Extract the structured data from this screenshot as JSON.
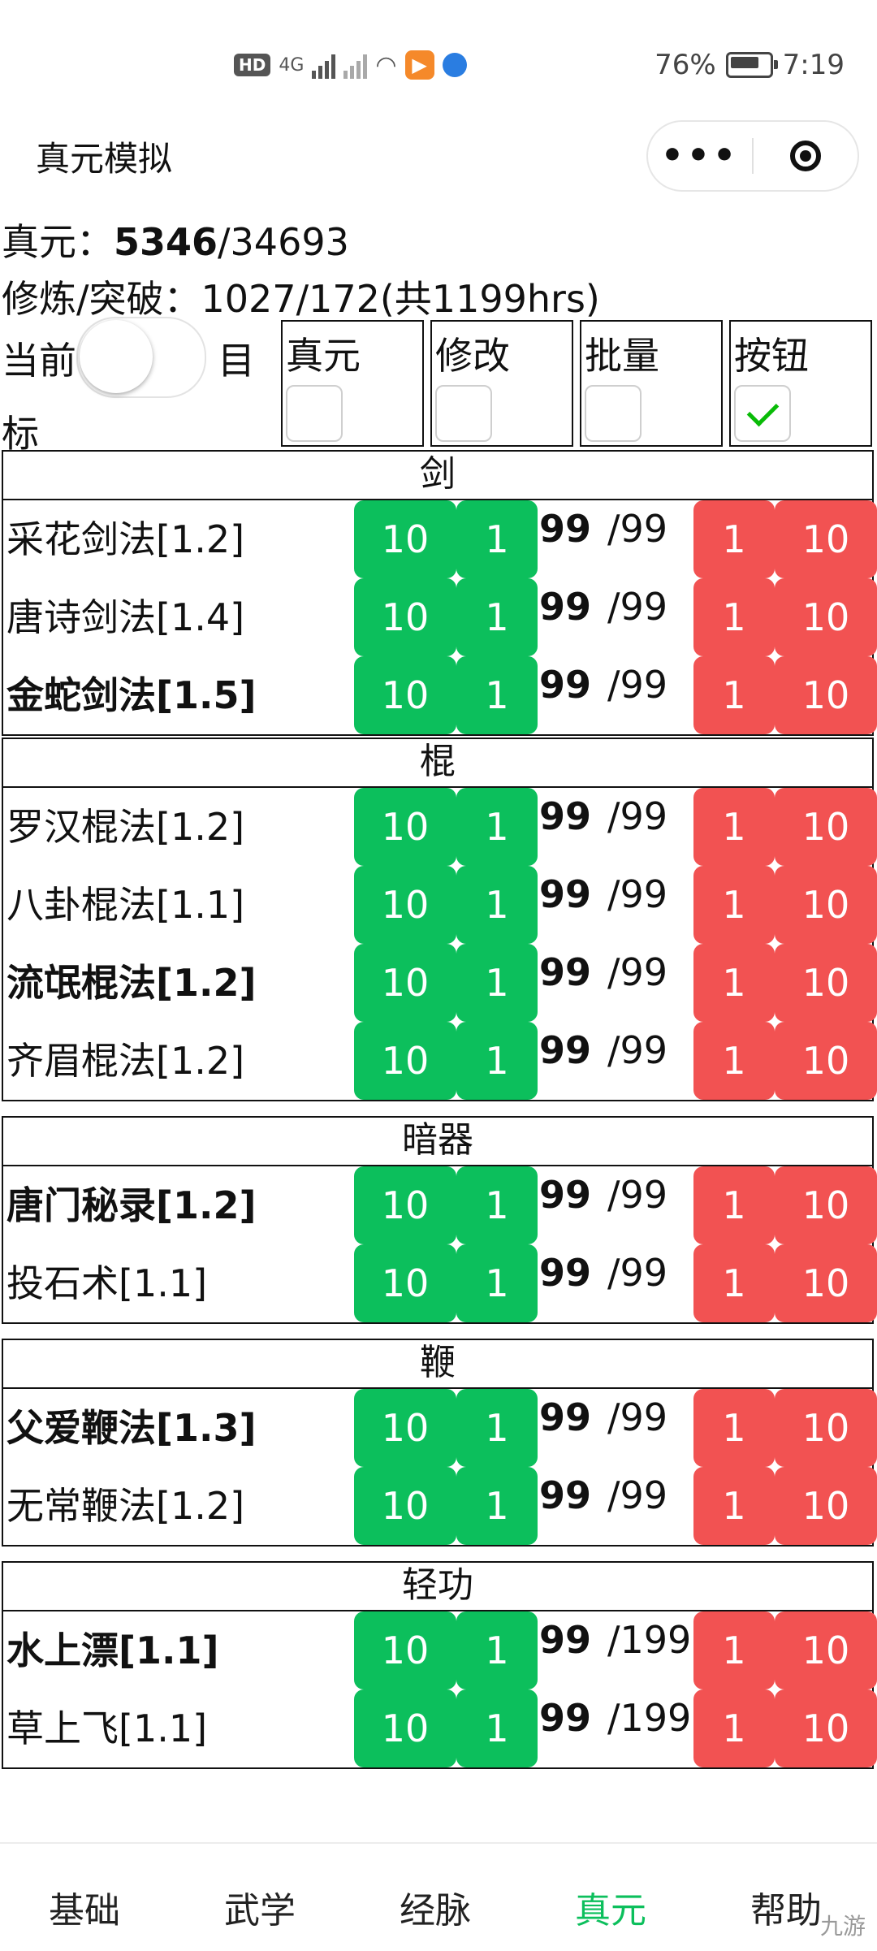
{
  "status_bar": {
    "hd_label": "HD",
    "network_label": "4G",
    "battery": "76%",
    "time": "7:19"
  },
  "nav": {
    "title": "真元模拟"
  },
  "summary": {
    "zhenyuan_label": "真元：",
    "zhenyuan_current": "5346",
    "zhenyuan_total": "/34693",
    "training_label": "修炼/突破：1027/172(共1199hrs)"
  },
  "toggle": {
    "left_label": "当前",
    "right_label_1": "目",
    "right_label_2": "标",
    "is_on": false
  },
  "options": [
    {
      "label": "真元",
      "checked": false
    },
    {
      "label": "修改",
      "checked": false
    },
    {
      "label": "批量",
      "checked": false
    },
    {
      "label": "按钮",
      "checked": true
    }
  ],
  "buttons": {
    "plus10": "10",
    "plus1": "1",
    "minus1": "1",
    "minus10": "10"
  },
  "groups": [
    {
      "title": "剑",
      "items": [
        {
          "name": "采花剑法[1.2]",
          "bold": false,
          "current": "99",
          "max": "/99"
        },
        {
          "name": "唐诗剑法[1.4]",
          "bold": false,
          "current": "99",
          "max": "/99"
        },
        {
          "name": "金蛇剑法[1.5]",
          "bold": true,
          "current": "99",
          "max": "/99"
        }
      ]
    },
    {
      "title": "棍",
      "items": [
        {
          "name": "罗汉棍法[1.2]",
          "bold": false,
          "current": "99",
          "max": "/99"
        },
        {
          "name": "八卦棍法[1.1]",
          "bold": false,
          "current": "99",
          "max": "/99"
        },
        {
          "name": "流氓棍法[1.2]",
          "bold": true,
          "current": "99",
          "max": "/99"
        },
        {
          "name": "齐眉棍法[1.2]",
          "bold": false,
          "current": "99",
          "max": "/99"
        }
      ]
    },
    {
      "title": "暗器",
      "items": [
        {
          "name": "唐门秘录[1.2]",
          "bold": true,
          "current": "99",
          "max": "/99"
        },
        {
          "name": "投石术[1.1]",
          "bold": false,
          "current": "99",
          "max": "/99"
        }
      ]
    },
    {
      "title": "鞭",
      "items": [
        {
          "name": "父爱鞭法[1.3]",
          "bold": true,
          "current": "99",
          "max": "/99"
        },
        {
          "name": "无常鞭法[1.2]",
          "bold": false,
          "current": "99",
          "max": "/99"
        }
      ]
    },
    {
      "title": "轻功",
      "items": [
        {
          "name": "水上漂[1.1]",
          "bold": true,
          "current": "99",
          "max": "/199"
        },
        {
          "name": "草上飞[1.1]",
          "bold": false,
          "current": "99",
          "max": "/199"
        }
      ]
    }
  ],
  "tabs": [
    {
      "label": "基础",
      "active": false
    },
    {
      "label": "武学",
      "active": false
    },
    {
      "label": "经脉",
      "active": false
    },
    {
      "label": "真元",
      "active": true
    },
    {
      "label": "帮助",
      "active": false
    }
  ],
  "watermark": "九游",
  "colors": {
    "green": "#0cbf5c",
    "red": "#f25252",
    "check": "#09bb07"
  }
}
